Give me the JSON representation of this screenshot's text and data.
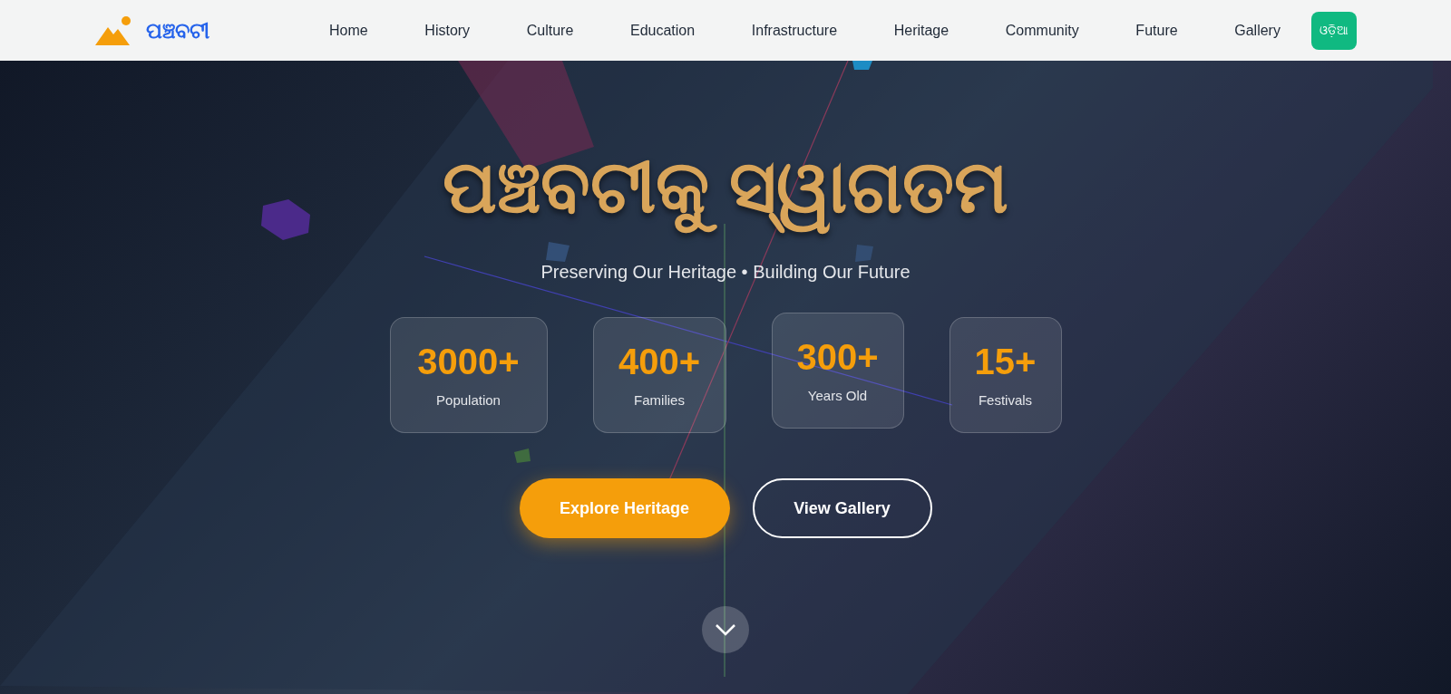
{
  "logo": {
    "text": "ପଞ୍ଚବଟୀ"
  },
  "nav": {
    "items": [
      {
        "label": "Home"
      },
      {
        "label": "History"
      },
      {
        "label": "Culture"
      },
      {
        "label": "Education"
      },
      {
        "label": "Infrastructure"
      },
      {
        "label": "Heritage"
      },
      {
        "label": "Community"
      },
      {
        "label": "Future"
      },
      {
        "label": "Gallery"
      }
    ],
    "language_button": "ଓଡ଼ିଆ"
  },
  "hero": {
    "title": "ପଞ୍ଚବଟୀକୁ ସ୍ୱାଗତମ",
    "subtitle": "Preserving Our Heritage • Building Our Future",
    "stats": [
      {
        "value": "3000+",
        "label": "Population"
      },
      {
        "value": "400+",
        "label": "Families"
      },
      {
        "value": "300+",
        "label": "Years Old"
      },
      {
        "value": "15+",
        "label": "Festivals"
      }
    ],
    "buttons": [
      {
        "label": "Explore Heritage",
        "kind": "primary"
      },
      {
        "label": "View Gallery",
        "kind": "outline"
      }
    ]
  }
}
